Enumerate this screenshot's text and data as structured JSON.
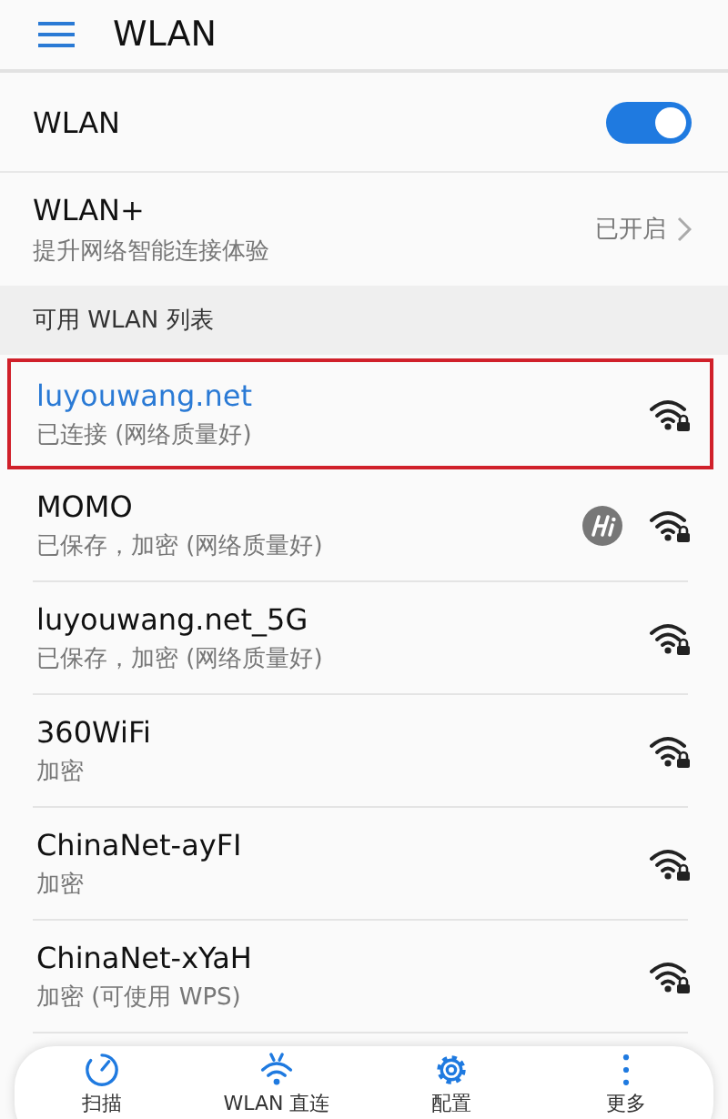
{
  "header": {
    "title": "WLAN"
  },
  "wlan_switch": {
    "label": "WLAN",
    "on": true
  },
  "wlan_plus": {
    "label": "WLAN+",
    "description": "提升网络智能连接体验",
    "status": "已开启"
  },
  "section_title": "可用 WLAN 列表",
  "networks": [
    {
      "name": "luyouwang.net",
      "status": "已连接 (网络质量好)",
      "connected": true,
      "highlighted": true,
      "hilink": false
    },
    {
      "name": "MOMO",
      "status": "已保存，加密 (网络质量好)",
      "connected": false,
      "highlighted": false,
      "hilink": true
    },
    {
      "name": "luyouwang.net_5G",
      "status": "已保存，加密 (网络质量好)",
      "connected": false,
      "highlighted": false,
      "hilink": false
    },
    {
      "name": "360WiFi",
      "status": "加密",
      "connected": false,
      "highlighted": false,
      "hilink": false
    },
    {
      "name": "ChinaNet-ayFI",
      "status": "加密",
      "connected": false,
      "highlighted": false,
      "hilink": false
    },
    {
      "name": "ChinaNet-xYaH",
      "status": "加密 (可使用 WPS)",
      "connected": false,
      "highlighted": false,
      "hilink": false
    }
  ],
  "toolbar": [
    {
      "kind": "scan",
      "label": "扫描"
    },
    {
      "kind": "direct",
      "label": "WLAN 直连"
    },
    {
      "kind": "config",
      "label": "配置"
    },
    {
      "kind": "more",
      "label": "更多"
    }
  ]
}
